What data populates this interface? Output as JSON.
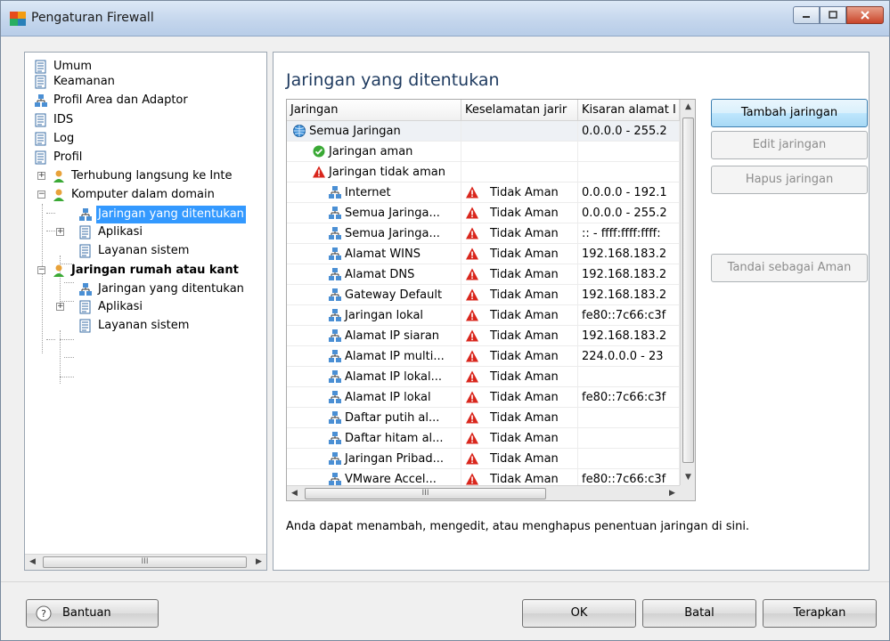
{
  "window": {
    "title": "Pengaturan Firewall"
  },
  "tree": {
    "items": [
      {
        "label": "Umum",
        "icon": "document-icon"
      },
      {
        "label": "Keamanan",
        "icon": "document-icon"
      },
      {
        "label": "Profil Area dan Adaptor",
        "icon": "network-icon"
      },
      {
        "label": "IDS",
        "icon": "document-icon"
      },
      {
        "label": "Log",
        "icon": "document-icon"
      },
      {
        "label": "Profil",
        "icon": "document-icon"
      },
      {
        "label": "Terhubung langsung ke Inte",
        "icon": "user-icon"
      },
      {
        "label": "Komputer dalam domain",
        "icon": "user-icon"
      },
      {
        "label": "Jaringan yang ditentukan",
        "icon": "network-icon"
      },
      {
        "label": "Aplikasi",
        "icon": "document-icon"
      },
      {
        "label": "Layanan sistem",
        "icon": "document-icon"
      },
      {
        "label": "Jaringan rumah atau kant",
        "icon": "user-icon"
      },
      {
        "label": "Jaringan yang ditentukan",
        "icon": "network-icon"
      },
      {
        "label": "Aplikasi",
        "icon": "document-icon"
      },
      {
        "label": "Layanan sistem",
        "icon": "document-icon"
      }
    ]
  },
  "main": {
    "title": "Jaringan yang ditentukan",
    "columns": [
      "Jaringan",
      "Keselamatan jarir",
      "Kisaran alamat I"
    ],
    "rows": [
      {
        "name": "Semua Jaringan",
        "safety": "",
        "range": "0.0.0.0 - 255.2"
      },
      {
        "name": "Jaringan aman",
        "safety": "",
        "range": ""
      },
      {
        "name": "Jaringan tidak aman",
        "safety": "",
        "range": ""
      },
      {
        "name": "Internet",
        "safety": "Tidak Aman",
        "range": "0.0.0.0 - 192.1"
      },
      {
        "name": "Semua Jaringa...",
        "safety": "Tidak Aman",
        "range": "0.0.0.0 - 255.2"
      },
      {
        "name": "Semua Jaringa...",
        "safety": "Tidak Aman",
        "range": ":: - ffff:ffff:ffff:"
      },
      {
        "name": "Alamat WINS",
        "safety": "Tidak Aman",
        "range": "192.168.183.2"
      },
      {
        "name": "Alamat DNS",
        "safety": "Tidak Aman",
        "range": "192.168.183.2"
      },
      {
        "name": "Gateway Default",
        "safety": "Tidak Aman",
        "range": "192.168.183.2"
      },
      {
        "name": "Jaringan lokal",
        "safety": "Tidak Aman",
        "range": "fe80::7c66:c3f"
      },
      {
        "name": "Alamat IP siaran",
        "safety": "Tidak Aman",
        "range": "192.168.183.2"
      },
      {
        "name": "Alamat IP multi...",
        "safety": "Tidak Aman",
        "range": "224.0.0.0 - 23"
      },
      {
        "name": "Alamat IP lokal...",
        "safety": "Tidak Aman",
        "range": ""
      },
      {
        "name": "Alamat IP lokal",
        "safety": "Tidak Aman",
        "range": "fe80::7c66:c3f"
      },
      {
        "name": "Daftar putih al...",
        "safety": "Tidak Aman",
        "range": ""
      },
      {
        "name": "Daftar hitam al...",
        "safety": "Tidak Aman",
        "range": ""
      },
      {
        "name": "Jaringan Pribad...",
        "safety": "Tidak Aman",
        "range": ""
      },
      {
        "name": "VMware Accel...",
        "safety": "Tidak Aman",
        "range": "fe80::7c66:c3f"
      }
    ],
    "description": "Anda dapat menambah, mengedit, atau menghapus penentuan jaringan di sini.",
    "hscroll_grip": "III"
  },
  "actions": {
    "add": "Tambah jaringan",
    "edit": "Edit jaringan",
    "delete": "Hapus jaringan",
    "mark_safe": "Tandai sebagai Aman"
  },
  "footer": {
    "help": "Bantuan",
    "ok": "OK",
    "cancel": "Batal",
    "apply": "Terapkan"
  },
  "colors": {
    "selection": "#3399ff",
    "title": "#1e3a5f",
    "warning": "#d9261c",
    "safe": "#3aa935"
  }
}
